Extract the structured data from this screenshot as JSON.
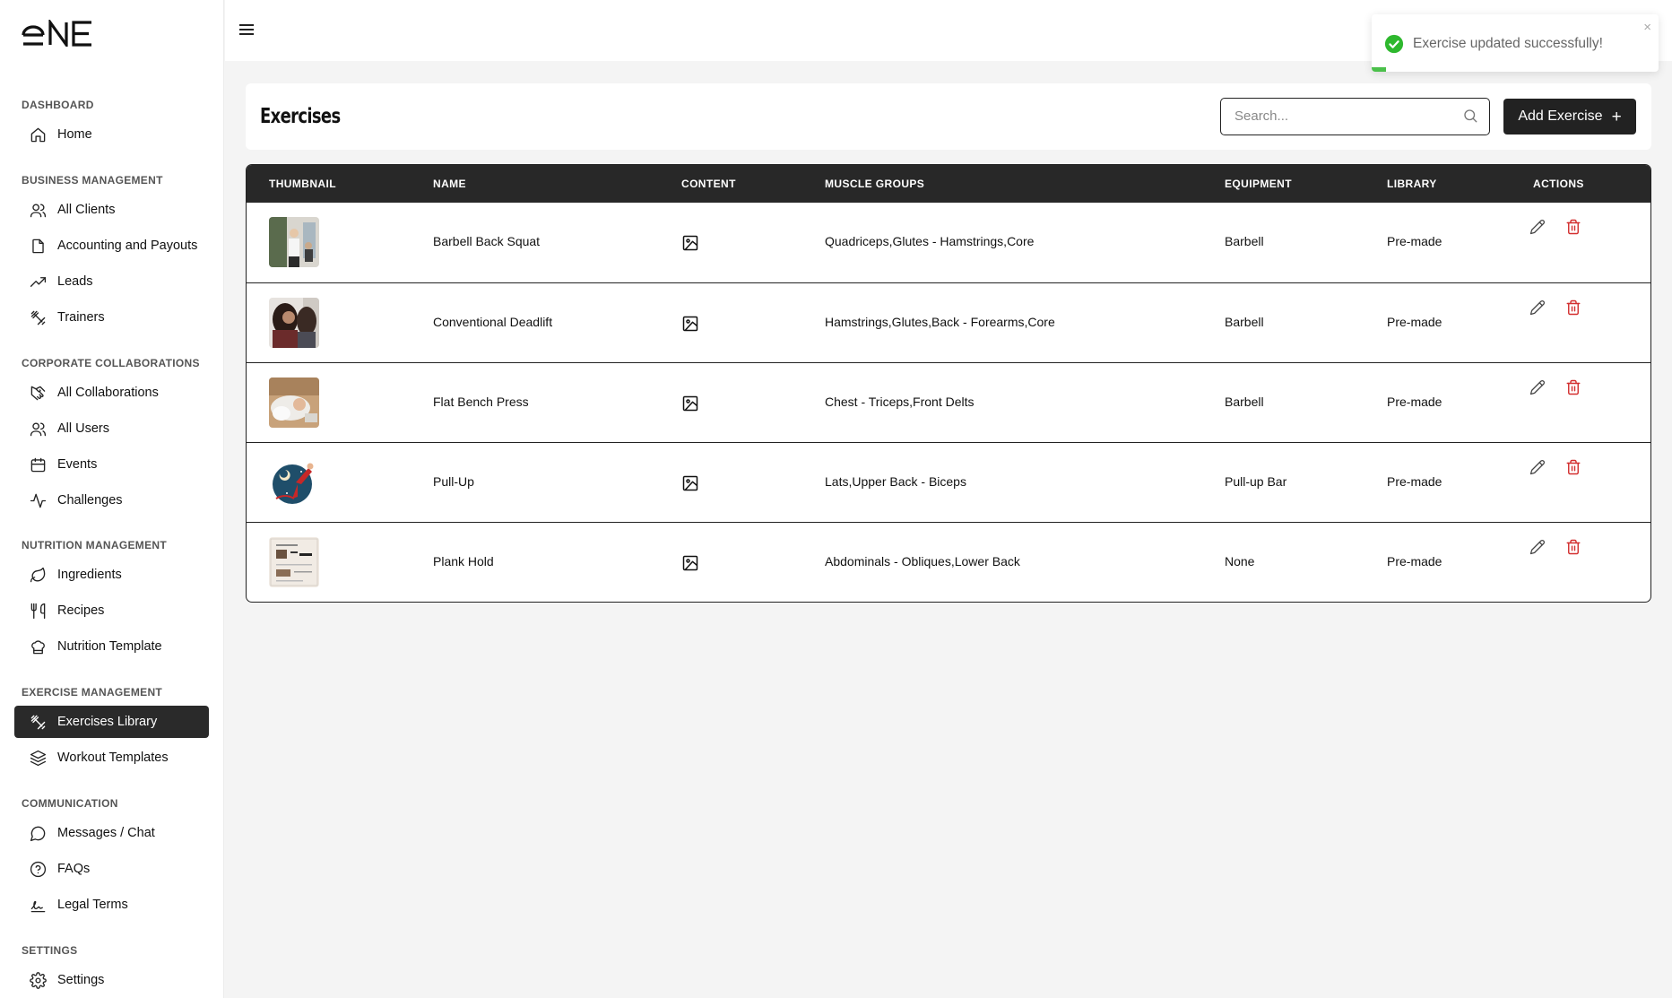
{
  "brand": {
    "logo_text": "ONE"
  },
  "sidebar": {
    "sections": [
      {
        "title": "DASHBOARD",
        "items": [
          {
            "label": "Home",
            "icon": "home-icon"
          }
        ]
      },
      {
        "title": "BUSINESS MANAGEMENT",
        "items": [
          {
            "label": "All Clients",
            "icon": "users-icon"
          },
          {
            "label": "Accounting and Payouts",
            "icon": "file-icon"
          },
          {
            "label": "Leads",
            "icon": "trending-up-icon"
          },
          {
            "label": "Trainers",
            "icon": "dumbbell-icon"
          }
        ]
      },
      {
        "title": "CORPORATE COLLABORATIONS",
        "items": [
          {
            "label": "All Collaborations",
            "icon": "handshake-icon"
          },
          {
            "label": "All Users",
            "icon": "users-icon"
          },
          {
            "label": "Events",
            "icon": "calendar-icon"
          },
          {
            "label": "Challenges",
            "icon": "activity-icon"
          }
        ]
      },
      {
        "title": "NUTRITION MANAGEMENT",
        "items": [
          {
            "label": "Ingredients",
            "icon": "leaf-icon"
          },
          {
            "label": "Recipes",
            "icon": "utensils-icon"
          },
          {
            "label": "Nutrition Template",
            "icon": "chef-hat-icon"
          }
        ]
      },
      {
        "title": "EXERCISE MANAGEMENT",
        "items": [
          {
            "label": "Exercises Library",
            "icon": "dumbbell-icon",
            "active": true
          },
          {
            "label": "Workout Templates",
            "icon": "layers-icon"
          }
        ]
      },
      {
        "title": "COMMUNICATION",
        "items": [
          {
            "label": "Messages / Chat",
            "icon": "message-circle-icon"
          },
          {
            "label": "FAQs",
            "icon": "help-circle-icon"
          },
          {
            "label": "Legal Terms",
            "icon": "signature-icon"
          }
        ]
      },
      {
        "title": "SETTINGS",
        "items": [
          {
            "label": "Settings",
            "icon": "gear-icon"
          }
        ]
      }
    ]
  },
  "header": {
    "title": "Exercises",
    "search_placeholder": "Search...",
    "add_label": "Add Exercise",
    "add_icon": "plus-icon"
  },
  "table": {
    "columns": [
      "THUMBNAIL",
      "NAME",
      "CONTENT",
      "MUSCLE GROUPS",
      "EQUIPMENT",
      "LIBRARY",
      "ACTIONS"
    ],
    "rows": [
      {
        "name": "Barbell Back Squat",
        "muscles": "Quadriceps,Glutes - Hamstrings,Core",
        "equipment": "Barbell",
        "library": "Pre-made"
      },
      {
        "name": "Conventional Deadlift",
        "muscles": "Hamstrings,Glutes,Back - Forearms,Core",
        "equipment": "Barbell",
        "library": "Pre-made"
      },
      {
        "name": "Flat Bench Press",
        "muscles": "Chest - Triceps,Front Delts",
        "equipment": "Barbell",
        "library": "Pre-made"
      },
      {
        "name": "Pull-Up",
        "muscles": "Lats,Upper Back - Biceps",
        "equipment": "Pull-up Bar",
        "library": "Pre-made"
      },
      {
        "name": "Plank Hold",
        "muscles": "Abdominals - Obliques,Lower Back",
        "equipment": "None",
        "library": "Pre-made"
      }
    ]
  },
  "toast": {
    "message": "Exercise updated successfully!",
    "close_glyph": "×",
    "progress": 0.05
  },
  "colors": {
    "accent": "#282828",
    "success": "#4bc04b",
    "danger": "#d32f2f"
  }
}
